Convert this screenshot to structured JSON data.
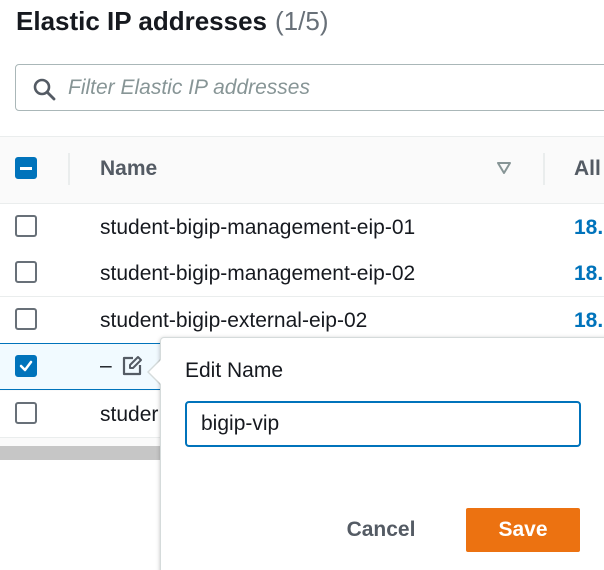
{
  "header": {
    "title": "Elastic IP addresses",
    "count": "(1/5)"
  },
  "search": {
    "placeholder": "Filter Elastic IP addresses",
    "value": "",
    "icon": "search-icon"
  },
  "table": {
    "columns": {
      "name": "Name",
      "allocated_ip": "All"
    },
    "select_all_state": "indeterminate",
    "rows": [
      {
        "name": "student-bigip-management-eip-01",
        "ip": "18.",
        "checked": false
      },
      {
        "name": "student-bigip-management-eip-02",
        "ip": "18.",
        "checked": false
      },
      {
        "name": "student-bigip-external-eip-02",
        "ip": "18.",
        "checked": false
      },
      {
        "name": "–",
        "ip": "",
        "checked": true,
        "editing": true
      },
      {
        "name": "studer",
        "ip": "",
        "checked": false
      }
    ]
  },
  "edit_popover": {
    "title": "Edit Name",
    "input_value": "bigip-vip",
    "cancel_label": "Cancel",
    "save_label": "Save"
  },
  "colors": {
    "accent": "#0073bb",
    "primary_button": "#ec7211",
    "text": "#16191f",
    "muted": "#545b64"
  }
}
